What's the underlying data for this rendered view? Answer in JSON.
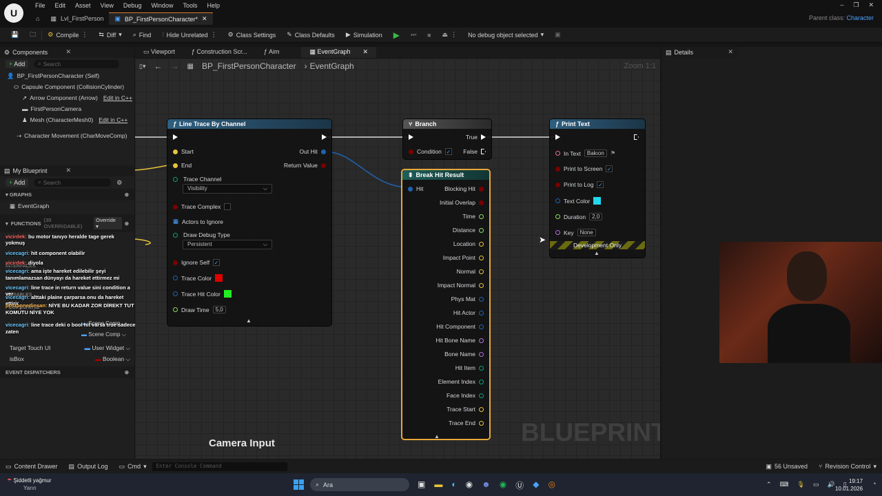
{
  "menu": [
    "File",
    "Edit",
    "Asset",
    "View",
    "Debug",
    "Window",
    "Tools",
    "Help"
  ],
  "tabs": {
    "level": "Lvl_FirstPerson",
    "blueprint": "BP_FirstPersonCharacter*"
  },
  "parent_class": {
    "label": "Parent class:",
    "value": "Character"
  },
  "toolbar": {
    "compile": "Compile",
    "diff": "Diff",
    "find": "Find",
    "hide_unrelated": "Hide Unrelated",
    "class_settings": "Class Settings",
    "class_defaults": "Class Defaults",
    "simulation": "Simulation",
    "debug_object": "No debug object selected"
  },
  "components": {
    "title": "Components",
    "add": "Add",
    "search": "Search",
    "items": [
      "BP_FirstPersonCharacter (Self)",
      "Capsule Component (CollisionCylinder)",
      "Arrow Component (Arrow)",
      "FirstPersonCamera",
      "Mesh (CharacterMesh0)",
      "Character Movement (CharMoveComp)"
    ],
    "edit_cpp": "Edit in C++"
  },
  "my_blueprint": {
    "title": "My Blueprint",
    "add": "Add",
    "search": "Search",
    "graphs": "GRAPHS",
    "event_graph": "EventGraph",
    "functions": "FUNCTIONS",
    "functions_count": "(39 OVERRIDABLE)",
    "override": "Override",
    "interfaces": "INTERFACES",
    "variables": "VARIABLES",
    "components": "Components",
    "event_dispatchers": "EVENT DISPATCHERS",
    "vars": [
      {
        "name": "Target Touch UI",
        "type": "User Widget"
      },
      {
        "name": "isBox",
        "type": "Boolean"
      }
    ],
    "scene_comp": "Scene Comp"
  },
  "graph_tabs": [
    "Viewport",
    "Construction Scr...",
    "Aim",
    "EventGraph"
  ],
  "breadcrumb": {
    "root": "BP_FirstPersonCharacter",
    "leaf": "EventGraph",
    "zoom": "Zoom 1:1"
  },
  "details": {
    "title": "Details"
  },
  "nodes": {
    "line_trace": {
      "title": "Line Trace By Channel",
      "start": "Start",
      "end": "End",
      "trace_channel": "Trace Channel",
      "channel_value": "Visibility",
      "trace_complex": "Trace Complex",
      "actors_to_ignore": "Actors to Ignore",
      "draw_debug_type": "Draw Debug Type",
      "debug_value": "Persistent",
      "ignore_self": "Ignore Self",
      "trace_color": "Trace Color",
      "trace_hit_color": "Trace Hit Color",
      "draw_time": "Draw Time",
      "draw_time_value": "5,0",
      "out_hit": "Out Hit",
      "return_value": "Return Value"
    },
    "branch": {
      "title": "Branch",
      "condition": "Condition",
      "true": "True",
      "false": "False"
    },
    "break_hit": {
      "title": "Break Hit Result",
      "hit": "Hit",
      "outputs": [
        "Blocking Hit",
        "Initial Overlap",
        "Time",
        "Distance",
        "Location",
        "Impact Point",
        "Normal",
        "Impact Normal",
        "Phys Mat",
        "Hit Actor",
        "Hit Component",
        "Hit Bone Name",
        "Bone Name",
        "Hit Item",
        "Element Index",
        "Face Index",
        "Trace Start",
        "Trace End"
      ]
    },
    "print_text": {
      "title": "Print Text",
      "in_text": "In Text",
      "in_text_value": "Bakıon",
      "print_to_screen": "Print to Screen",
      "print_to_log": "Print to Log",
      "text_color": "Text Color",
      "duration": "Duration",
      "duration_value": "2,0",
      "key": "Key",
      "key_value": "None",
      "dev_only": "Development Only"
    }
  },
  "comment": "Camera Input",
  "watermark": "BLUEPRINT",
  "chat": [
    {
      "user": "vicirdek:",
      "msg": "bu motor tanıyo heralde tage gerek yokmuş"
    },
    {
      "user": "vicecagri:",
      "msg": "hit component olabilir"
    },
    {
      "user": "vicirdek:",
      "msg": "diyola"
    },
    {
      "user": "vicecagri:",
      "msg": "ama işte hareket edilebilir şeyi tanımlamazsan dünyayı da hareket ettirmez mi"
    },
    {
      "user": "vicecagri:",
      "msg": "line trace in return value sini condition a ver"
    },
    {
      "user": "vicecagri:",
      "msg": "alttaki plaine çarparsa onu da hareket ettirir"
    },
    {
      "user": "postponedinsan:",
      "msg": "NİYE BU KADAR ZOR DİREKT TUT KOMUTU NİYE YOK"
    },
    {
      "user": "vicecagri:",
      "msg": "line trace deki o bool hit varsa true sadece zaten"
    }
  ],
  "statusbar": {
    "content_drawer": "Content Drawer",
    "output_log": "Output Log",
    "cmd": "Cmd",
    "console_placeholder": "Enter Console Command",
    "unsaved": "56 Unsaved",
    "revision": "Revision Control"
  },
  "taskbar": {
    "weather": "Şiddetli yağmur",
    "weather_sub": "Yarın",
    "search": "Ara",
    "time": "19:17",
    "date": "10.01.2026"
  },
  "colors": {
    "accent": "#d27c2a",
    "function_header": "#2f5f7f",
    "trace_color": "#e00000",
    "trace_hit_color": "#22ee22",
    "text_color": "#22d8ee"
  }
}
